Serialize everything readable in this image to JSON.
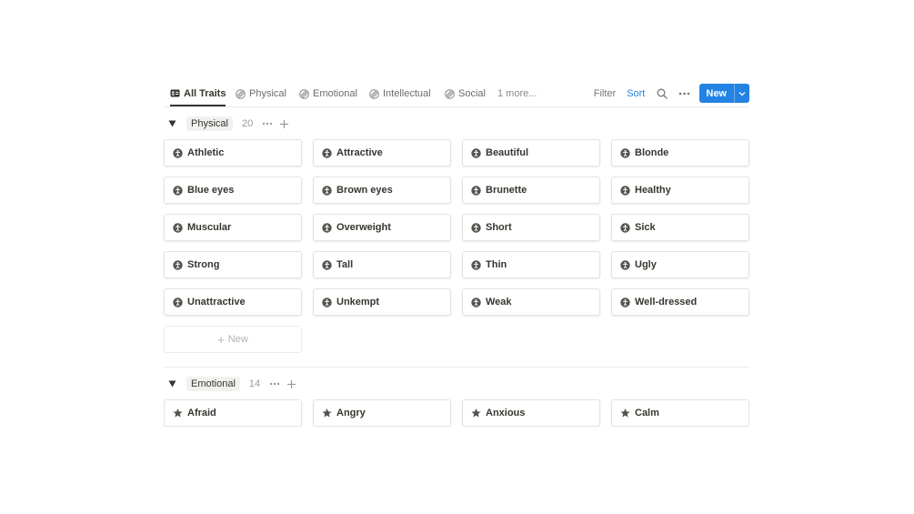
{
  "tabs": [
    {
      "label": "All Traits",
      "icon": "card-icon",
      "active": true
    },
    {
      "label": "Physical",
      "icon": "hatched-circle-icon"
    },
    {
      "label": "Emotional",
      "icon": "hatched-circle-icon"
    },
    {
      "label": "Intellectual",
      "icon": "hatched-circle-icon"
    },
    {
      "label": "Social",
      "icon": "hatched-circle-icon"
    }
  ],
  "more_tabs": "1 more...",
  "toolbar": {
    "filter": "Filter",
    "sort": "Sort",
    "new_label": "New"
  },
  "colors": {
    "accent": "#2383e2",
    "text": "#37352f",
    "muted": "#787774"
  },
  "groups": [
    {
      "name": "Physical",
      "count": "20",
      "icon": "person-circle-icon",
      "items": [
        "Athletic",
        "Attractive",
        "Beautiful",
        "Blonde",
        "Blue eyes",
        "Brown eyes",
        "Brunette",
        "Healthy",
        "Muscular",
        "Overweight",
        "Short",
        "Sick",
        "Strong",
        "Tall",
        "Thin",
        "Ugly",
        "Unattractive",
        "Unkempt",
        "Weak",
        "Well-dressed"
      ],
      "new_label": "New"
    },
    {
      "name": "Emotional",
      "count": "14",
      "icon": "star-icon",
      "items": [
        "Afraid",
        "Angry",
        "Anxious",
        "Calm"
      ]
    }
  ]
}
